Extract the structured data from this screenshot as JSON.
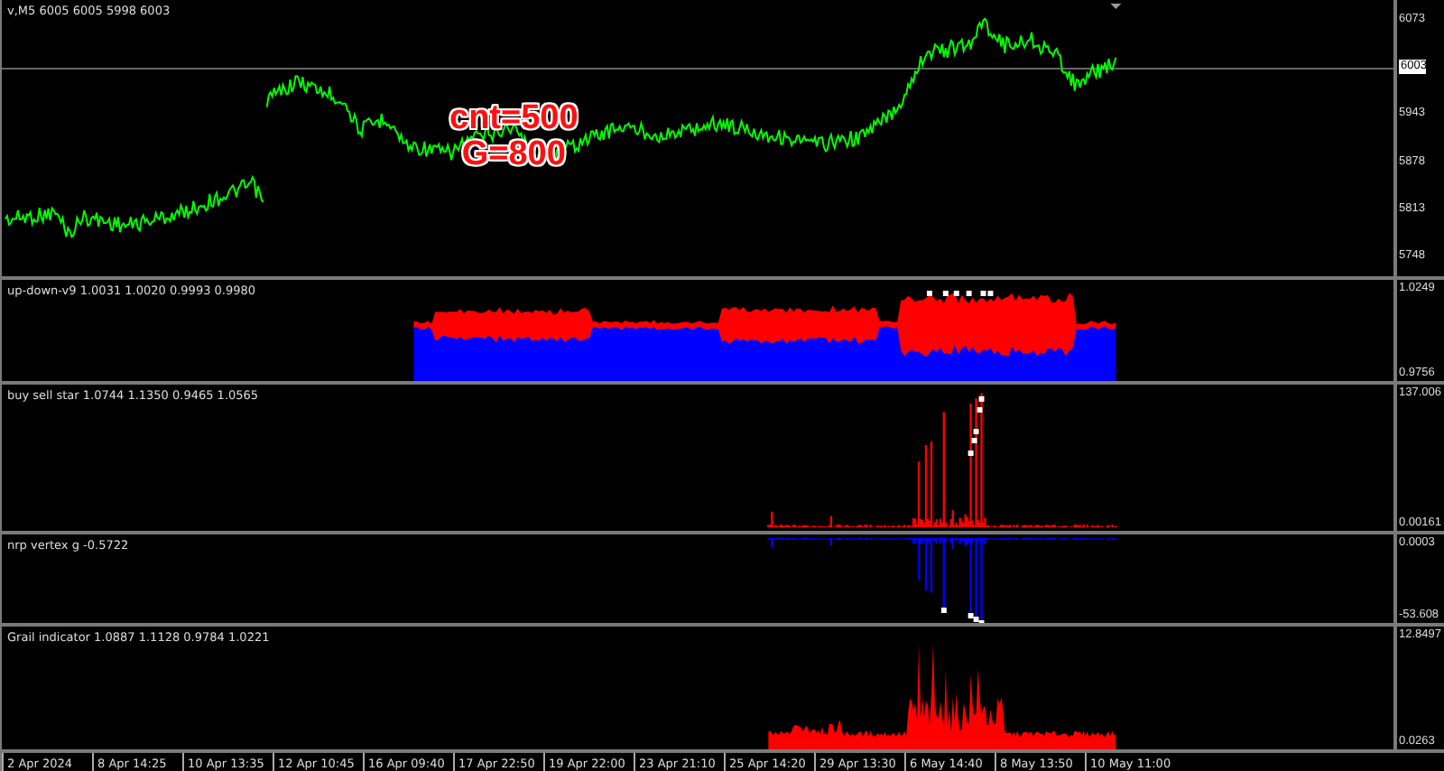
{
  "overlay_lines": [
    "cnt=500",
    "G=800"
  ],
  "panes": [
    {
      "kind": "price",
      "title": "v,M5  6005 6005 5998 6003",
      "scale_labels": [
        {
          "text": "6073",
          "current": false
        },
        {
          "text": "6003",
          "current": true
        },
        {
          "text": "5943",
          "current": false
        },
        {
          "text": "5878",
          "current": false
        },
        {
          "text": "5813",
          "current": false
        },
        {
          "text": "5748",
          "current": false
        }
      ]
    },
    {
      "kind": "band",
      "title": "up-down-v9 1.0031 1.0020 0.9993 0.9980",
      "scale_labels": [
        {
          "text": "1.0249",
          "current": false
        },
        {
          "text": "0.9756",
          "current": false
        }
      ]
    },
    {
      "kind": "spikes-up",
      "title": "buy sell star 1.0744 1.1350 0.9465 1.0565",
      "scale_labels": [
        {
          "text": "137.006",
          "current": false
        },
        {
          "text": "0.00161",
          "current": false
        }
      ]
    },
    {
      "kind": "spikes-down",
      "title": "nrp vertex g -0.5722",
      "scale_labels": [
        {
          "text": "0.0003",
          "current": false
        },
        {
          "text": "-53.608",
          "current": false
        }
      ]
    },
    {
      "kind": "area",
      "title": "Grail indicator 1.0887 1.1128 0.9784 1.0221",
      "scale_labels": [
        {
          "text": "12.8497",
          "current": false
        },
        {
          "text": "0.0263",
          "current": false
        }
      ]
    }
  ],
  "time_labels": [
    "2 Apr 2024",
    "8 Apr 14:25",
    "10 Apr 13:35",
    "12 Apr 10:45",
    "16 Apr 09:40",
    "17 Apr 22:50",
    "19 Apr 22:00",
    "23 Apr 21:10",
    "25 Apr 14:20",
    "29 Apr 13:30",
    "6 May 14:40",
    "8 May 13:50",
    "10 May 11:00"
  ]
}
